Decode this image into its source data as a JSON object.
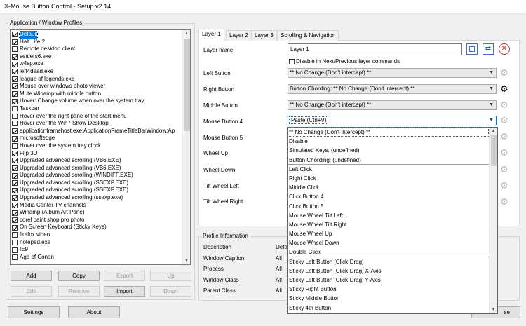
{
  "window": {
    "title": "X-Mouse Button Control - Setup v2.14"
  },
  "profiles": {
    "label": "Application / Window Profiles:",
    "items": [
      {
        "label": "Default",
        "checked": true,
        "selected": true
      },
      {
        "label": "Half Life 2",
        "checked": true
      },
      {
        "label": "Remote desktop client",
        "checked": false
      },
      {
        "label": "settlers6.exe",
        "checked": true
      },
      {
        "label": "w4sp.exe",
        "checked": true
      },
      {
        "label": "left4dead.exe",
        "checked": true
      },
      {
        "label": "league of legends.exe",
        "checked": true
      },
      {
        "label": "Mouse over windows photo viewer",
        "checked": true
      },
      {
        "label": "Mute Winamp with middle button",
        "checked": true
      },
      {
        "label": "Hover: Change volume when over the system tray",
        "checked": true
      },
      {
        "label": "Taskbar",
        "checked": false
      },
      {
        "label": "Hover over the right pane of the start menu",
        "checked": false
      },
      {
        "label": "Hover over the Win7 Show Desktop",
        "checked": false
      },
      {
        "label": "applicationframehost.exe;ApplicationFrameTitleBarWindow;Ap",
        "checked": true
      },
      {
        "label": "microsoftedge",
        "checked": true
      },
      {
        "label": "Hover over the system tray clock",
        "checked": false
      },
      {
        "label": "Flip 3D",
        "checked": true
      },
      {
        "label": "Upgraded advanced scrolling (VB6.EXE)",
        "checked": true
      },
      {
        "label": "Upgraded advanced scrolling (VB6.EXE)",
        "checked": true
      },
      {
        "label": "Upgraded advanced scrolling (WINDIFF.EXE)",
        "checked": true
      },
      {
        "label": "Upgraded advanced scrolling (SSEXP.EXE)",
        "checked": true
      },
      {
        "label": "Upgraded advanced scrolling (SSEXP.EXE)",
        "checked": true
      },
      {
        "label": "Upgraded advanced scrolling (ssexp.exe)",
        "checked": true
      },
      {
        "label": "Media Center TV channels",
        "checked": true
      },
      {
        "label": "Winamp (Album Art Pane)",
        "checked": true
      },
      {
        "label": "corel paint shop pro photo",
        "checked": true
      },
      {
        "label": "On Screen Keyboard (Sticky Keys)",
        "checked": true
      },
      {
        "label": "firefox video",
        "checked": false
      },
      {
        "label": "notepad.exe",
        "checked": false
      },
      {
        "label": "IE9",
        "checked": false
      },
      {
        "label": "Age of Conan",
        "checked": false
      }
    ]
  },
  "profile_buttons": {
    "add": "Add",
    "copy": "Copy",
    "export": "Export",
    "up": "Up",
    "edit": "Edit",
    "remove": "Remove",
    "import": "Import",
    "down": "Down"
  },
  "bottom_buttons": {
    "settings": "Settings",
    "about": "About",
    "close_partial": "se"
  },
  "tabs": [
    "Layer 1",
    "Layer 2",
    "Layer 3",
    "Scrolling & Navigation"
  ],
  "layer": {
    "name_label": "Layer name",
    "name_value": "Layer 1",
    "disable_label": "Disable in Next/Previous layer commands",
    "rows": [
      {
        "label": "Left Button",
        "value": "** No Change (Don't intercept) **"
      },
      {
        "label": "Right Button",
        "value": "Button Chording: ** No Change (Don't intercept) **"
      },
      {
        "label": "Middle Button",
        "value": "** No Change (Don't intercept) **"
      },
      {
        "label": "Mouse Button 4",
        "value": "Paste (Ctrl+V)"
      },
      {
        "label": "Mouse Button 5",
        "value": ""
      },
      {
        "label": "Wheel Up",
        "value": ""
      },
      {
        "label": "Wheel Down",
        "value": ""
      },
      {
        "label": "Tilt Wheel Left",
        "value": ""
      },
      {
        "label": "Tilt Wheel Right",
        "value": ""
      }
    ]
  },
  "dropdown_options": [
    "** No Change (Don't intercept) **",
    "Disable",
    "Simulated Keys: (undefined)",
    "Button Chording: (undefined)",
    "Left Click",
    "Right Click",
    "Middle Click",
    "Click Button 4",
    "Click Button 5",
    "Mouse Wheel Tilt Left",
    "Mouse Wheel Tilt Right",
    "Mouse Wheel Up",
    "Mouse Wheel Down",
    "Double Click",
    "Sticky Left Button [Click-Drag]",
    "Sticky Left Button [Click-Drag] X-Axis",
    "Sticky Left Button [Click-Drag] Y-Axis",
    "Sticky Right Button",
    "Sticky Middle Button",
    "Sticky 4th Button"
  ],
  "profile_info": {
    "title": "Profile Information",
    "labels": [
      "Description",
      "Window Caption",
      "Process",
      "Window Class",
      "Parent Class"
    ],
    "values": [
      "Defa",
      "All",
      "All",
      "All",
      "All"
    ]
  },
  "colors": {
    "accent": "#0078d7",
    "dropdown_border": "#646464"
  }
}
